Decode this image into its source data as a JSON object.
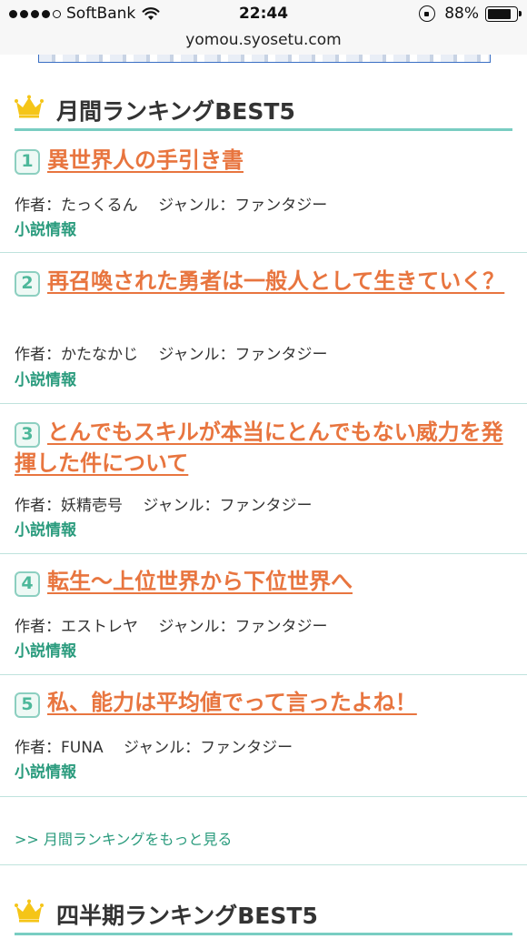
{
  "status_bar": {
    "carrier": "SoftBank",
    "time": "22:44",
    "battery": "88%",
    "battery_level": 0.88
  },
  "browser": {
    "url": "yomou.syosetu.com"
  },
  "monthly": {
    "title": "月間ランキングBEST5",
    "items": [
      {
        "rank": "1",
        "title": "異世界人の手引き書",
        "meta": "作者：たっくるん　 ジャンル：ファンタジー",
        "info": "小説情報"
      },
      {
        "rank": "2",
        "title": "再召喚された勇者は一般人として生きていく？",
        "meta": "作者：かたなかじ　 ジャンル：ファンタジー",
        "info": "小説情報"
      },
      {
        "rank": "3",
        "title": "とんでもスキルが本当にとんでもない威力を発揮した件について",
        "meta": "作者：妖精壱号　 ジャンル：ファンタジー",
        "info": "小説情報"
      },
      {
        "rank": "4",
        "title": "転生～上位世界から下位世界へ",
        "meta": "作者：エストレヤ　 ジャンル：ファンタジー",
        "info": "小説情報"
      },
      {
        "rank": "5",
        "title": "私、能力は平均値でって言ったよね！",
        "meta": "作者：FUNA　 ジャンル：ファンタジー",
        "info": "小説情報"
      }
    ],
    "more_link": ">> 月間ランキングをもっと見る"
  },
  "quarterly": {
    "title": "四半期ランキングBEST5"
  },
  "icons": {
    "crown": "crown-icon",
    "wifi": "wifi-icon",
    "rotation_lock": "rotation-lock-icon",
    "battery": "battery-icon"
  },
  "colors": {
    "accent": "#79cdc2",
    "title_link": "#e8753f",
    "info_link": "#2a9b7d",
    "crown": "#f5c518"
  }
}
